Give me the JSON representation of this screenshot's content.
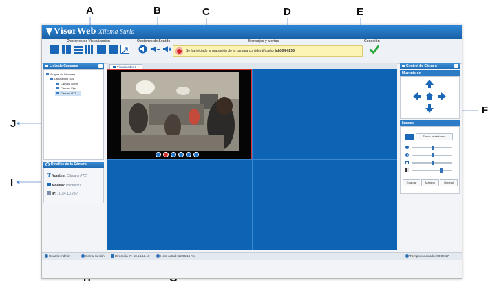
{
  "callouts": {
    "A": "A",
    "B": "B",
    "C": "C",
    "D": "D",
    "E": "E",
    "F": "F",
    "G": "G",
    "H": "H",
    "I": "I",
    "J": "J"
  },
  "app": {
    "brand": "VisorWeb",
    "subtitle": "Xilema Suria"
  },
  "toolbar": {
    "view_options_label": "Opciones de Visualización",
    "sound_options_label": "Opciones de Sonido",
    "messages_label": "Mensajes y alertas",
    "connection_label": "Conexión",
    "message_text_prefix": "Se ha iniciado la grabación de la cámara con identificador ",
    "message_id": "lab304-0256"
  },
  "camera_list": {
    "title": "Lista de Cámaras",
    "items": [
      {
        "label": "Grupos de Cámaras"
      },
      {
        "label": "Laboratorio 304"
      },
      {
        "label": "Cámara Domo"
      },
      {
        "label": "Cámara Fija"
      },
      {
        "label": "Cámara PTZ"
      }
    ]
  },
  "camera_details": {
    "title": "Detalles de la Cámara",
    "name_label": "Nombre:",
    "name_value": "Cámara PTZ",
    "model_label": "Modelo:",
    "model_value": "vivotek50",
    "ip_label": "IP:",
    "ip_value": "10.54.13.250"
  },
  "viewer": {
    "tab_label": "Visualizador 1"
  },
  "camera_control": {
    "title": "Control de Cámara",
    "movement_label": "Movimiento",
    "image_label": "Imagen",
    "snapshot_label": "Tomar instantánea",
    "save_label": "Guardar",
    "max_label": "Máximo",
    "original_label": "Original",
    "sliders": [
      0.5,
      0.5,
      0.5,
      0.7
    ]
  },
  "statusbar": {
    "user": "Usuario: Admin",
    "logout": "Cerrar Sesión",
    "ip": "Dirección IP: 10.54.13.10",
    "time": "Hora Actual: 12:05:16 AM",
    "connected": "Tiempo conectado: 00:00:17"
  },
  "colors": {
    "accent": "#1a67b8",
    "video_bg": "#0d64b5",
    "record_red": "#d62b2b",
    "ok_green": "#2aa83a"
  }
}
